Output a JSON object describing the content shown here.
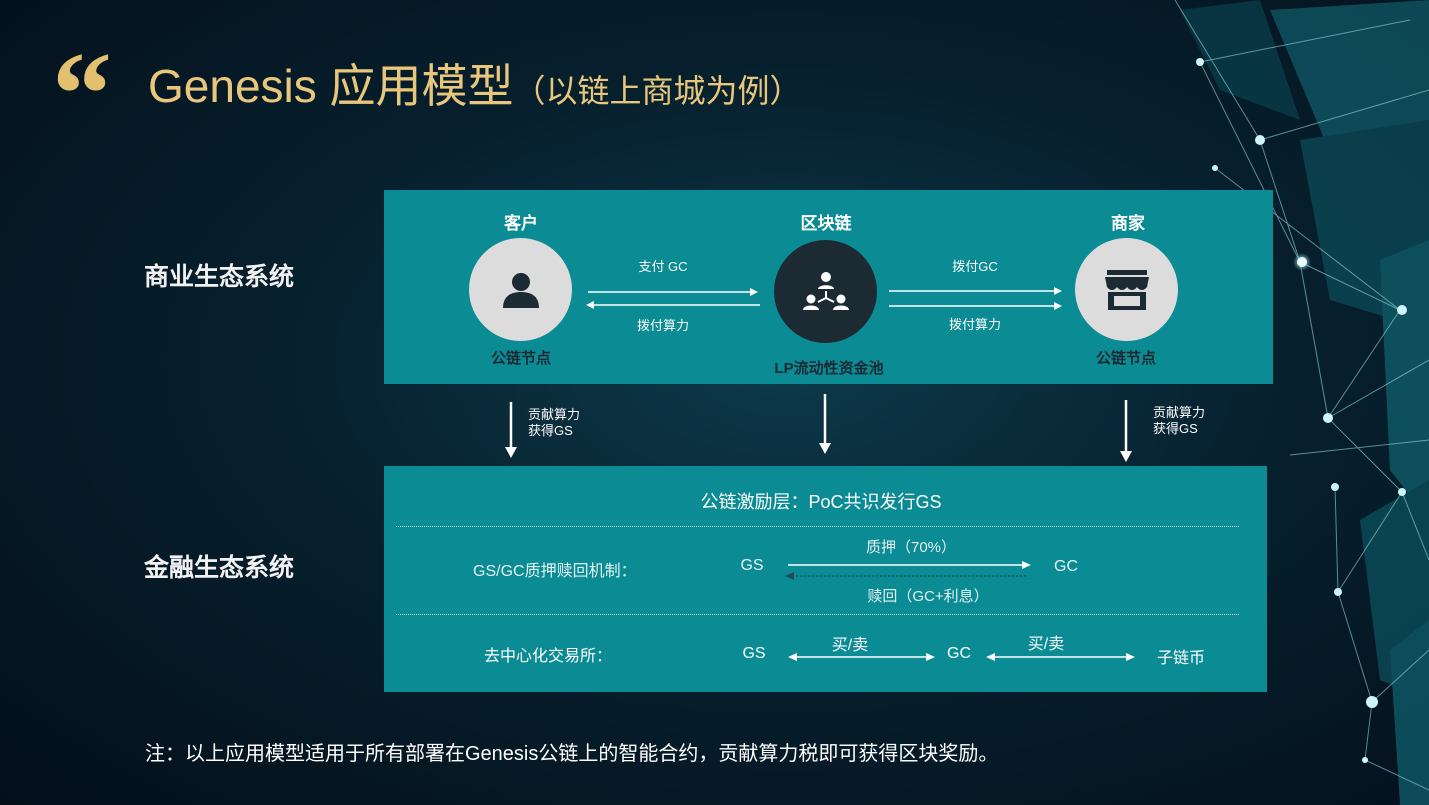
{
  "header": {
    "title": "Genesis 应用模型",
    "subtitle": "（以链上商城为例）",
    "quote_mark": "“"
  },
  "rows": {
    "business": "商业生态系统",
    "finance": "金融生态系统"
  },
  "business_panel": {
    "customer": {
      "title": "客户",
      "caption": "公链节点",
      "icon": "user-icon"
    },
    "blockchain": {
      "title": "区块链",
      "caption": "LP流动性资金池",
      "icon": "network-nodes-icon"
    },
    "merchant": {
      "title": "商家",
      "caption": "公链节点",
      "icon": "store-icon"
    },
    "left_arrows": {
      "top": "支付 GC",
      "bottom": "拨付算力"
    },
    "right_arrows": {
      "top": "拨付GC",
      "bottom": "拨付算力"
    }
  },
  "down_arrows": {
    "left": [
      "贡献算力",
      "获得GS"
    ],
    "right": [
      "贡献算力",
      "获得GS"
    ]
  },
  "finance_panel": {
    "incentive": "公链激励层：PoC共识发行GS",
    "staking": {
      "label": "GS/GC质押赎回机制：",
      "from": "GS",
      "to": "GC",
      "forward": "质押（70%）",
      "backward": "赎回（GC+利息）"
    },
    "exchange": {
      "label": "去中心化交易所：",
      "a": "GS",
      "b": "GC",
      "c": "子链币",
      "ab": "买/卖",
      "bc": "买/卖"
    }
  },
  "note": "注：以上应用模型适用于所有部署在Genesis公链上的智能合约，贡献算力税即可获得区块奖励。",
  "colors": {
    "panel": "#0b8b94",
    "title_gold": "#e8c77c",
    "dark_circle": "#1c2a33",
    "light_circle": "#dcdcdc"
  }
}
